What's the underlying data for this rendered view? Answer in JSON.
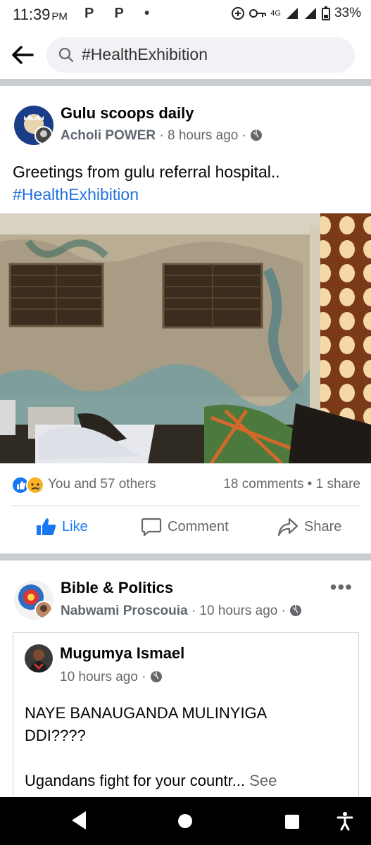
{
  "status_bar": {
    "time": "11:39",
    "ampm": "PM",
    "apps": "P P •",
    "network": "4G",
    "battery": "33%"
  },
  "search": {
    "query": "#HealthExhibition"
  },
  "post1": {
    "page_name": "Gulu scoops daily",
    "author": "Acholi POWER",
    "time": "8 hours ago",
    "text_line1": "Greetings from gulu referral hospital..",
    "hashtag": "#HealthExhibition",
    "reactions_text": "You and 57 others",
    "comments": "18 comments",
    "shares": "1 share"
  },
  "actions": {
    "like": "Like",
    "comment": "Comment",
    "share": "Share"
  },
  "post2": {
    "page_name": "Bible & Politics",
    "author": "Nabwami Proscouia",
    "time": "10 hours ago",
    "more": "•••",
    "shared": {
      "author": "Mugumya Ismael",
      "time": "10 hours ago",
      "line1": "NAYE BANAUGANDA  MULINYIGA",
      "line2": "DDI????",
      "line3": "Ugandans  fight  for your countr...",
      "see_more": "See"
    }
  },
  "colors": {
    "facebook_blue": "#1877f2",
    "meta_gray": "#65676b",
    "divider_gray": "#c9ccd1"
  },
  "icons": [
    "back-arrow-icon",
    "search-icon",
    "globe-icon",
    "like-reaction-icon",
    "sad-reaction-icon",
    "thumbs-up-icon",
    "comment-icon",
    "share-icon",
    "nav-back-icon",
    "nav-home-icon",
    "nav-recents-icon",
    "accessibility-icon"
  ]
}
